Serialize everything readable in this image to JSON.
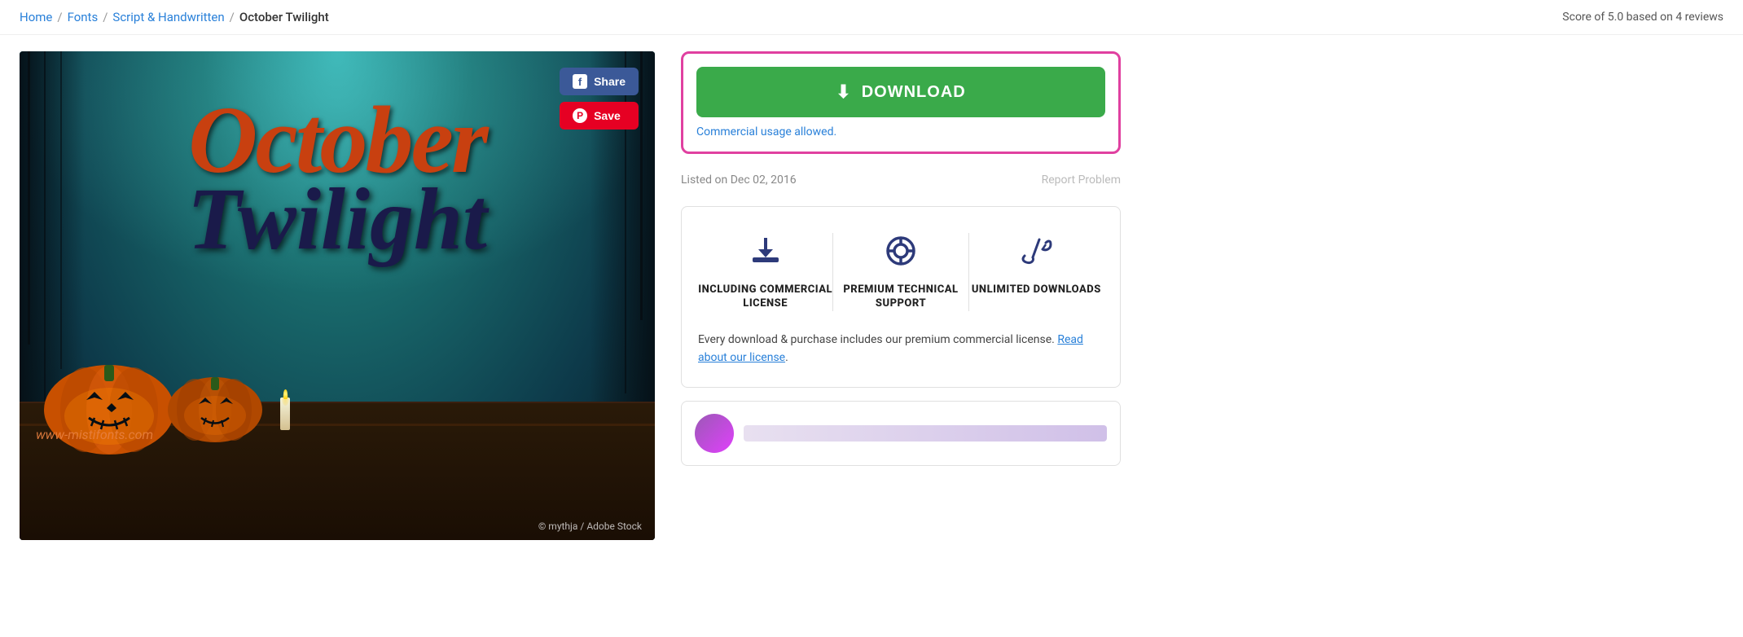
{
  "breadcrumb": {
    "home": "Home",
    "fonts": "Fonts",
    "category": "Script & Handwritten",
    "current": "October Twilight",
    "sep": "/"
  },
  "score": {
    "text": "Score of 5.0 based on 4 reviews"
  },
  "preview": {
    "october_text": "October",
    "twilight_text": "Twilight",
    "watermark": "www-mistifonts.com",
    "copyright": "© mythja / Adobe Stock"
  },
  "buttons": {
    "share": "Share",
    "save": "Save",
    "download": "DOWNLOAD",
    "commercial": "Commercial usage allowed."
  },
  "listing": {
    "listed_on": "Listed on Dec 02, 2016",
    "report": "Report Problem"
  },
  "features": [
    {
      "label": "INCLUDING COMMERCIAL LICENSE",
      "icon": "⬇",
      "name": "commercial-license-feature"
    },
    {
      "label": "PREMIUM TECHNICAL SUPPORT",
      "icon": "◎",
      "name": "technical-support-feature"
    },
    {
      "label": "UNLIMITED DOWNLOADS",
      "icon": "✒",
      "name": "unlimited-downloads-feature"
    }
  ],
  "license_text": "Every download & purchase includes our premium commercial license.",
  "license_link": "Read about our license",
  "icons": {
    "facebook": "f",
    "pinterest": "p",
    "download_arrow": "⬇"
  }
}
